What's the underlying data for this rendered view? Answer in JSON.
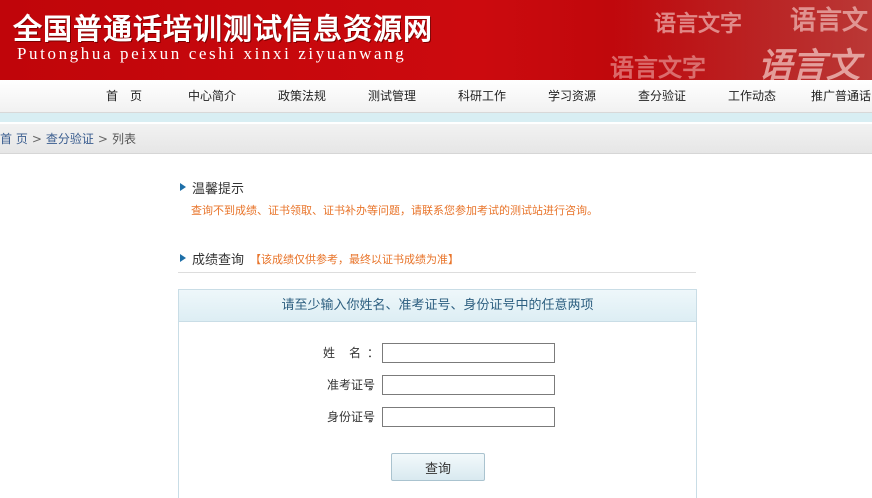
{
  "banner": {
    "title": "全国普通话培训测试信息资源网",
    "subtitle": "Putonghua peixun ceshi xinxi ziyuanwang",
    "decor_1": "语言文字",
    "decor_2": "语言文",
    "decor_3": "语言文字",
    "decor_4": "语言文"
  },
  "nav": {
    "items": [
      "首页",
      "中心简介",
      "政策法规",
      "测试管理",
      "科研工作",
      "学习资源",
      "查分验证",
      "工作动态",
      "推广普通话"
    ]
  },
  "breadcrumb": {
    "home": "首 页",
    "section": "查分验证",
    "current": "列表",
    "separator": ">"
  },
  "notice": {
    "heading": "温馨提示",
    "text": "查询不到成绩、证书领取、证书补办等问题，请联系您参加考试的测试站进行咨询。"
  },
  "score": {
    "heading": "成绩查询",
    "note": "【该成绩仅供参考，最终以证书成绩为准】"
  },
  "form": {
    "instruction": "请至少输入你姓名、准考证号、身份证号中的任意两项",
    "name_label": "姓名",
    "ticket_label": "准考证号",
    "id_label": "身份证号",
    "colon": "：",
    "name_value": "",
    "ticket_value": "",
    "id_value": "",
    "submit_label": "查询"
  },
  "colors": {
    "banner_red": "#c0050a",
    "notice_orange": "#e8742a",
    "marker_blue": "#1e6fa8",
    "panel_border": "#c9dde6"
  }
}
